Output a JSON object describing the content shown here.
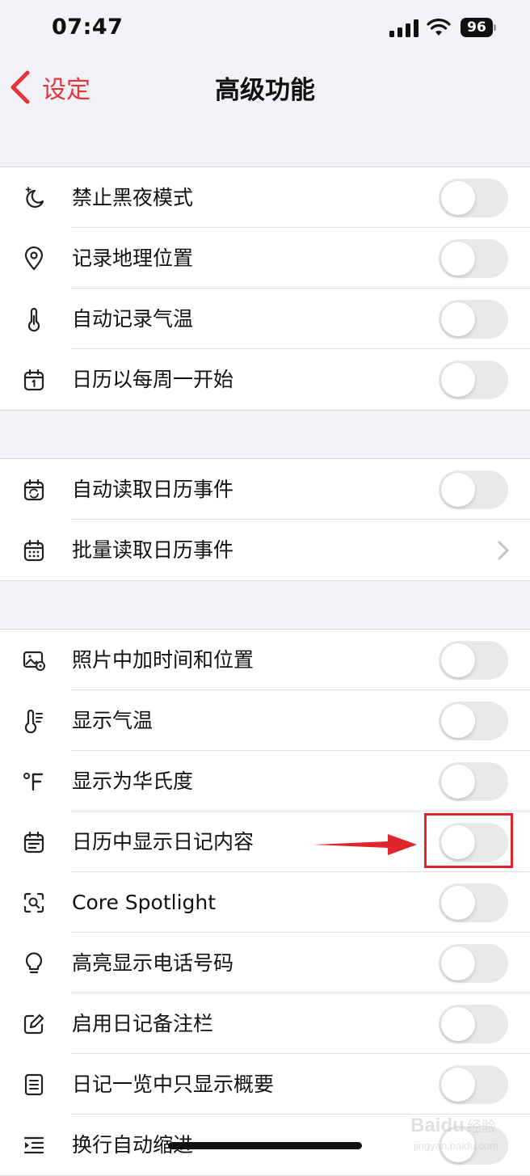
{
  "status": {
    "time": "07:47",
    "battery": "96"
  },
  "nav": {
    "back_label": "设定",
    "title": "高级功能"
  },
  "groups": [
    [
      {
        "icon": "moon-stars-icon",
        "label": "禁止黑夜模式",
        "control": "toggle",
        "on": false
      },
      {
        "icon": "location-pin-icon",
        "label": "记录地理位置",
        "control": "toggle",
        "on": false
      },
      {
        "icon": "thermometer-icon",
        "label": "自动记录气温",
        "control": "toggle",
        "on": false
      },
      {
        "icon": "calendar-one-icon",
        "label": "日历以每周一开始",
        "control": "toggle",
        "on": false
      }
    ],
    [
      {
        "icon": "calendar-sync-icon",
        "label": "自动读取日历事件",
        "control": "toggle",
        "on": false
      },
      {
        "icon": "calendar-grid-icon",
        "label": "批量读取日历事件",
        "control": "chevron"
      }
    ],
    [
      {
        "icon": "photo-location-icon",
        "label": "照片中加时间和位置",
        "control": "toggle",
        "on": false
      },
      {
        "icon": "thermometer-lines-icon",
        "label": "显示气温",
        "control": "toggle",
        "on": false
      },
      {
        "icon": "fahrenheit-icon",
        "label": "显示为华氏度",
        "control": "toggle",
        "on": false
      },
      {
        "icon": "calendar-text-icon",
        "label": "日历中显示日记内容",
        "control": "toggle",
        "on": false
      },
      {
        "icon": "spotlight-icon",
        "label": "Core Spotlight",
        "control": "toggle",
        "on": false
      },
      {
        "icon": "lightbulb-icon",
        "label": "高亮显示电话号码",
        "control": "toggle",
        "on": false
      },
      {
        "icon": "edit-square-icon",
        "label": "启用日记备注栏",
        "control": "toggle",
        "on": false
      },
      {
        "icon": "document-lines-icon",
        "label": "日记一览中只显示概要",
        "control": "toggle",
        "on": false
      },
      {
        "icon": "indent-icon",
        "label": "换行自动缩进",
        "control": "toggle",
        "on": false
      }
    ]
  ],
  "watermark": {
    "brand": "Baidu",
    "cn": "经验",
    "url": "jingyan.baidu.com"
  },
  "colors": {
    "accent": "#e5343a",
    "annotation": "#e0262c",
    "toggle_off": "#e9e9eb"
  }
}
